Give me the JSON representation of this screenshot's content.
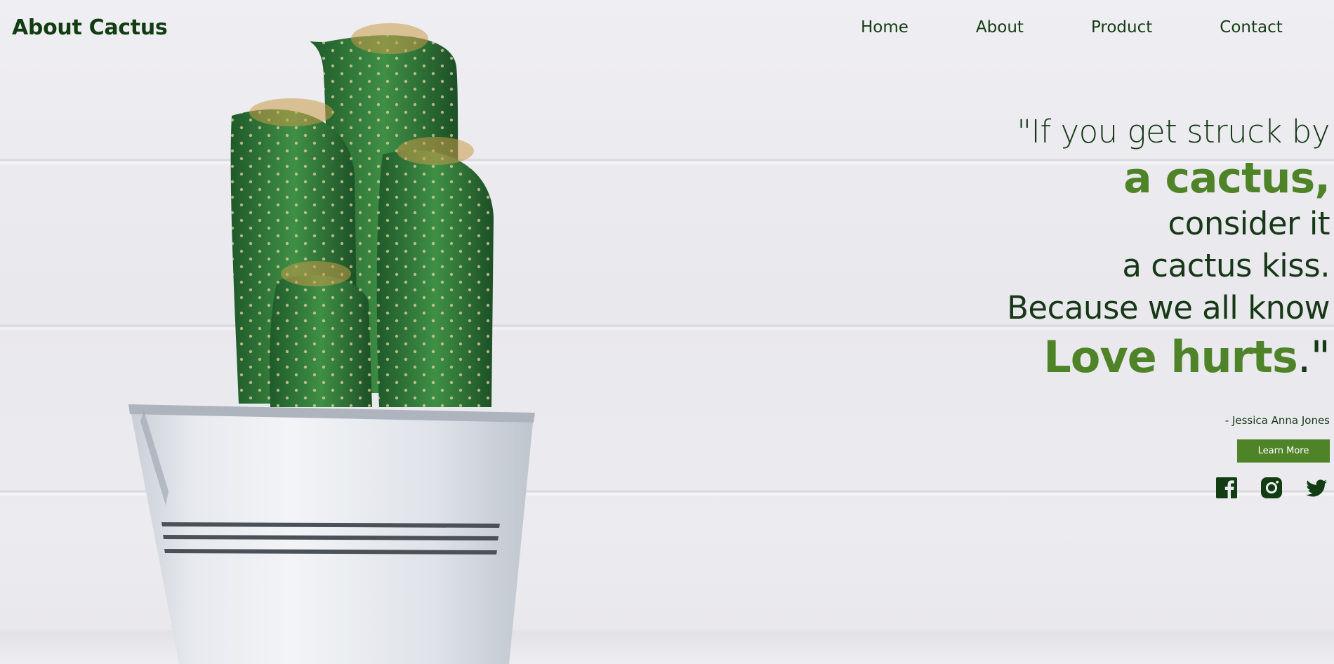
{
  "header": {
    "logo": "About Cactus",
    "nav": [
      "Home",
      "About",
      "Product",
      "Contact"
    ]
  },
  "hero": {
    "quote": {
      "line1": "\"If you get struck by",
      "line2": "a cactus,",
      "line3": "consider it",
      "line4": "a cactus kiss.",
      "line5": "Because we all know",
      "line6_highlight": "Love hurts",
      "line6_end": ".\""
    },
    "author": "- Jessica Anna Jones",
    "cta_label": "Learn More",
    "socials": [
      "facebook-icon",
      "instagram-icon",
      "twitter-icon"
    ]
  },
  "colors": {
    "brand_green": "#4f8328",
    "text_dark": "#143a14",
    "background": "#ecebef"
  }
}
